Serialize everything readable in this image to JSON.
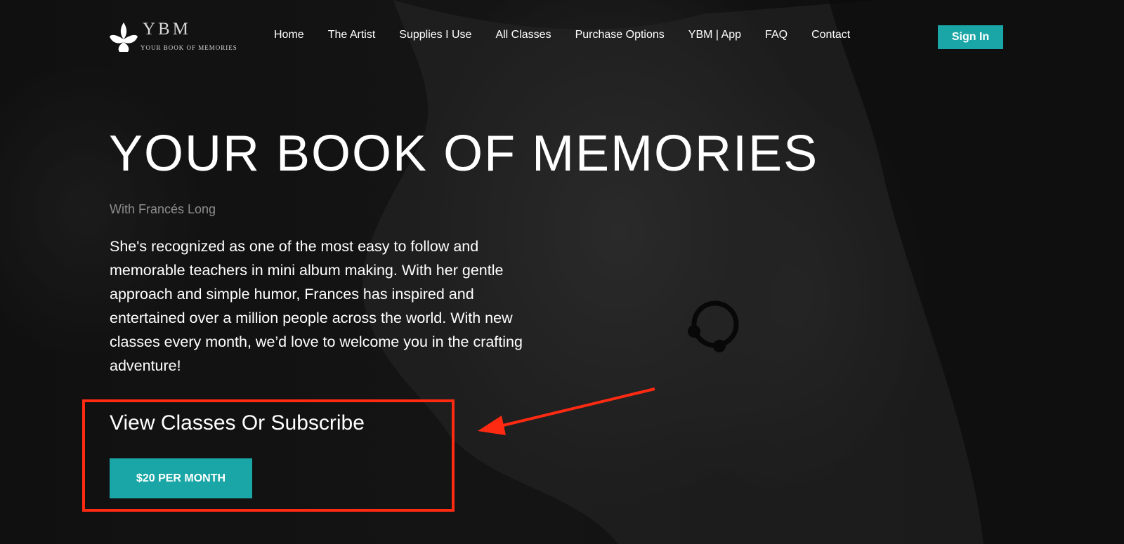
{
  "header": {
    "logo": {
      "letters": "YBM",
      "tagline": "YOUR BOOK OF MEMORIES"
    },
    "nav": [
      {
        "label": "Home"
      },
      {
        "label": "The Artist"
      },
      {
        "label": "Supplies I Use"
      },
      {
        "label": "All Classes"
      },
      {
        "label": "Purchase Options"
      },
      {
        "label": "YBM | App"
      },
      {
        "label": "FAQ"
      },
      {
        "label": "Contact"
      }
    ],
    "signin_label": "Sign In"
  },
  "hero": {
    "title": "YOUR BOOK OF MEMORIES",
    "subtitle": "With Francés Long",
    "description": "She's recognized as one of the most easy to follow and memorable teachers in mini album making. With her gentle approach and simple humor, Frances has inspired and entertained over a million people across the world. With new classes every month, we’d love to welcome you in the crafting adventure!",
    "cta_heading": "View Classes Or Subscribe",
    "cta_button": "$20 PER MONTH"
  },
  "colors": {
    "accent": "#1aa6a6",
    "annotation": "#ff2a12",
    "subtitle": "#8d8d8d"
  },
  "icons": {
    "logo_mark": "lotus-leaf-icon"
  }
}
